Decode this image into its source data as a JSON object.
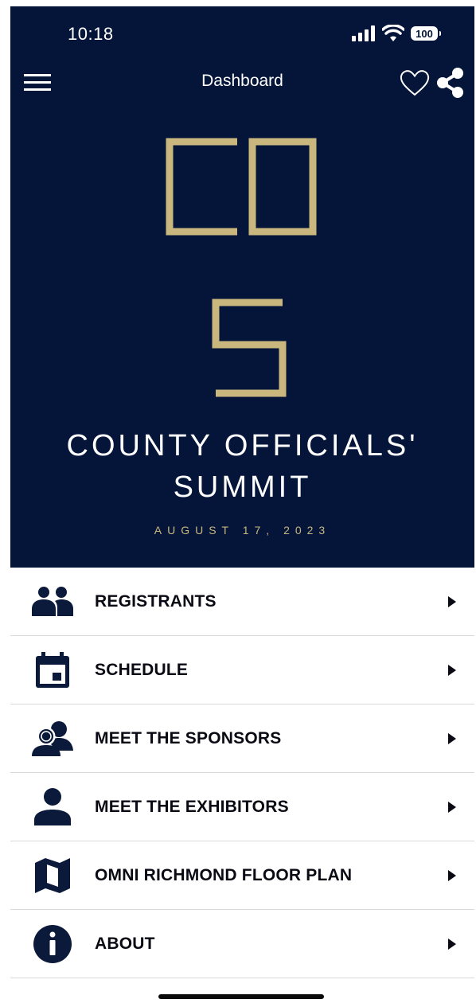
{
  "status_bar": {
    "time": "10:18",
    "battery": "100"
  },
  "header": {
    "title": "Dashboard"
  },
  "event": {
    "title_line1": "COUNTY OFFICIALS'",
    "title_line2": "SUMMIT",
    "date": "AUGUST 17, 2023"
  },
  "menu": {
    "items": [
      {
        "label": "REGISTRANTS",
        "icon": "people-icon"
      },
      {
        "label": "SCHEDULE",
        "icon": "calendar-icon"
      },
      {
        "label": "MEET THE SPONSORS",
        "icon": "sponsors-icon"
      },
      {
        "label": "MEET THE EXHIBITORS",
        "icon": "person-icon"
      },
      {
        "label": "OMNI RICHMOND FLOOR PLAN",
        "icon": "map-icon"
      },
      {
        "label": "ABOUT",
        "icon": "info-icon"
      }
    ]
  },
  "colors": {
    "navy": "#05153a",
    "gold": "#c9b77d",
    "menu_icon": "#0b1a3a"
  }
}
